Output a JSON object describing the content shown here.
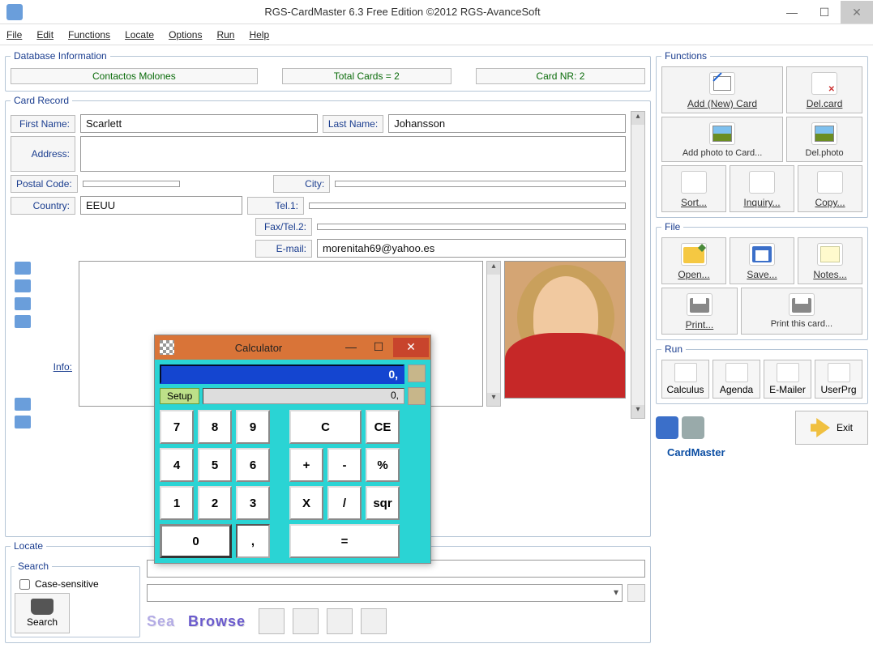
{
  "window": {
    "title": "RGS-CardMaster 6.3 Free Edition ©2012 RGS-AvanceSoft"
  },
  "menu": [
    "File",
    "Edit",
    "Functions",
    "Locate",
    "Options",
    "Run",
    "Help"
  ],
  "dbinfo": {
    "legend": "Database Information",
    "name": "Contactos Molones",
    "total": "Total Cards = 2",
    "nr": "Card NR: 2"
  },
  "cardrec": {
    "legend": "Card Record",
    "labels": {
      "first_name": "First Name:",
      "last_name": "Last Name:",
      "address": "Address:",
      "postal": "Postal Code:",
      "city": "City:",
      "country": "Country:",
      "tel1": "Tel.1:",
      "fax": "Fax/Tel.2:",
      "email": "E-mail:",
      "info": "Info:"
    },
    "values": {
      "first_name": "Scarlett",
      "last_name": "Johansson",
      "address": "",
      "postal": "",
      "city": "",
      "country": "EEUU",
      "tel1": "",
      "fax": "",
      "email": "morenitah69@yahoo.es"
    }
  },
  "locate": {
    "legend": "Locate",
    "search_legend": "Search",
    "case_label": "Case-sensitive",
    "search_btn": "Search",
    "search_word": "Sea",
    "browse_word": "Browse"
  },
  "functions": {
    "legend": "Functions",
    "add_card": "Add (New) Card",
    "del_card": "Del.card",
    "add_photo": "Add photo to Card...",
    "del_photo": "Del.photo",
    "sort": "Sort...",
    "inquiry": "Inquiry...",
    "copy": "Copy..."
  },
  "file": {
    "legend": "File",
    "open": "Open...",
    "save": "Save...",
    "notes": "Notes...",
    "print": "Print...",
    "print_card": "Print this card..."
  },
  "run": {
    "legend": "Run",
    "calculus": "Calculus",
    "agenda": "Agenda",
    "emailer": "E-Mailer",
    "userprg": "UserPrg"
  },
  "footer": {
    "brand": "CardMaster",
    "exit": "Exit"
  },
  "calc": {
    "title": "Calculator",
    "display1": "0,",
    "display2": "0,",
    "setup": "Setup",
    "keys": {
      "k7": "7",
      "k8": "8",
      "k9": "9",
      "kc": "C",
      "kce": "CE",
      "k4": "4",
      "k5": "5",
      "k6": "6",
      "kplus": "+",
      "kminus": "-",
      "kpct": "%",
      "k1": "1",
      "k2": "2",
      "k3": "3",
      "kx": "X",
      "kdiv": "/",
      "ksqr": "sqr",
      "k0": "0",
      "kdot": ",",
      "keq": "="
    }
  }
}
